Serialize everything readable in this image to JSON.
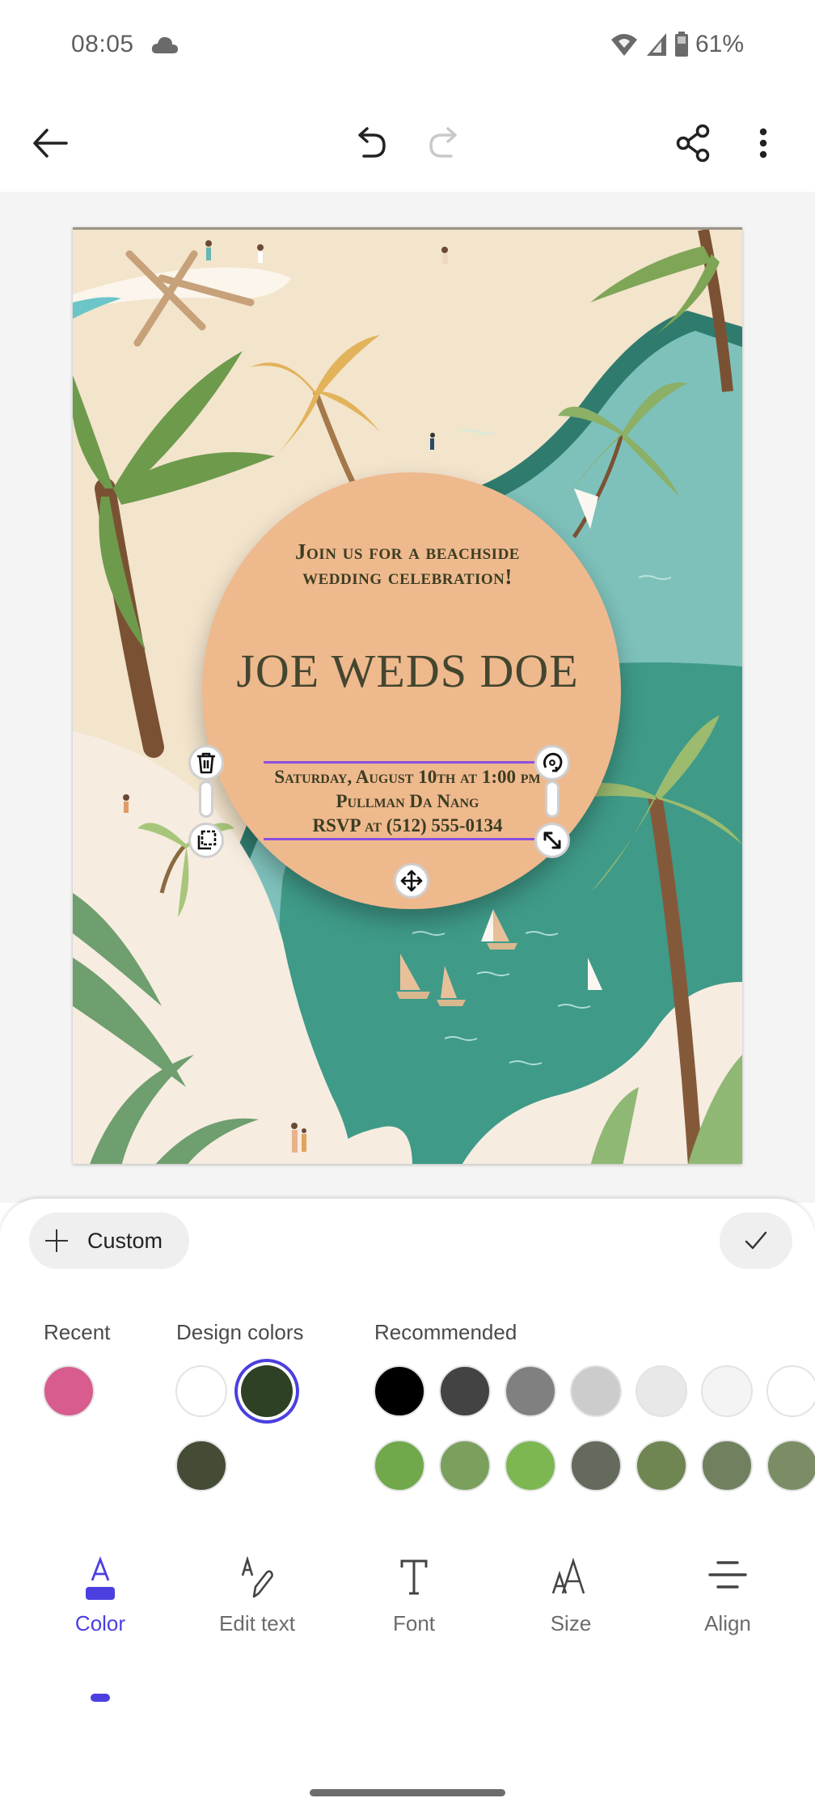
{
  "status_bar": {
    "time": "08:05",
    "weather_icon": "cloud-icon",
    "wifi_icon": "wifi-icon",
    "signal_icon": "cell-signal-icon",
    "battery_icon": "battery-icon",
    "battery_percent": "61%"
  },
  "app_bar": {
    "back_icon": "arrow-left-icon",
    "undo_icon": "undo-icon",
    "redo_icon": "redo-icon",
    "redo_enabled": false,
    "share_icon": "share-icon",
    "more_icon": "more-vertical-icon"
  },
  "invitation": {
    "intro_line_1": "Join us for a beachside",
    "intro_line_2": "wedding celebration!",
    "title": "JOE WEDS DOE",
    "details_line_1": "Saturday, August 10th at 1:00 pm",
    "details_line_2": "Pullman Da Nang",
    "details_line_3": "RSVP at (512) 555-0134",
    "selected_element": "details",
    "handles": [
      "trash-icon",
      "rotate-icon",
      "duplicate-icon",
      "resize-icon",
      "move-icon"
    ]
  },
  "color_sheet": {
    "custom_label": "Custom",
    "confirm_icon": "check-icon",
    "groups": {
      "recent": {
        "label": "Recent",
        "colors": [
          "#d85c8e"
        ]
      },
      "design": {
        "label": "Design colors",
        "colors": [
          "#ffffff",
          "#2f4124",
          "#444c35"
        ],
        "selected": "#2f4124"
      },
      "recommended": {
        "label": "Recommended",
        "row1": [
          "#000000",
          "#434343",
          "#808080",
          "#cccccc",
          "#e8e8e8",
          "#f4f4f4",
          "#ffffff"
        ],
        "row2": [
          "#70a84b",
          "#7ba05e",
          "#7db752",
          "#646a5c",
          "#6f8552",
          "#71805f",
          "#7b8d65"
        ]
      }
    }
  },
  "toolbar": {
    "active": "Color",
    "accent_color": "#4b3fe0",
    "items": [
      {
        "label": "Color",
        "icon": "text-color-icon"
      },
      {
        "label": "Edit text",
        "icon": "edit-text-icon"
      },
      {
        "label": "Font",
        "icon": "font-icon"
      },
      {
        "label": "Size",
        "icon": "text-size-icon"
      },
      {
        "label": "Align",
        "icon": "align-center-icon"
      }
    ]
  }
}
